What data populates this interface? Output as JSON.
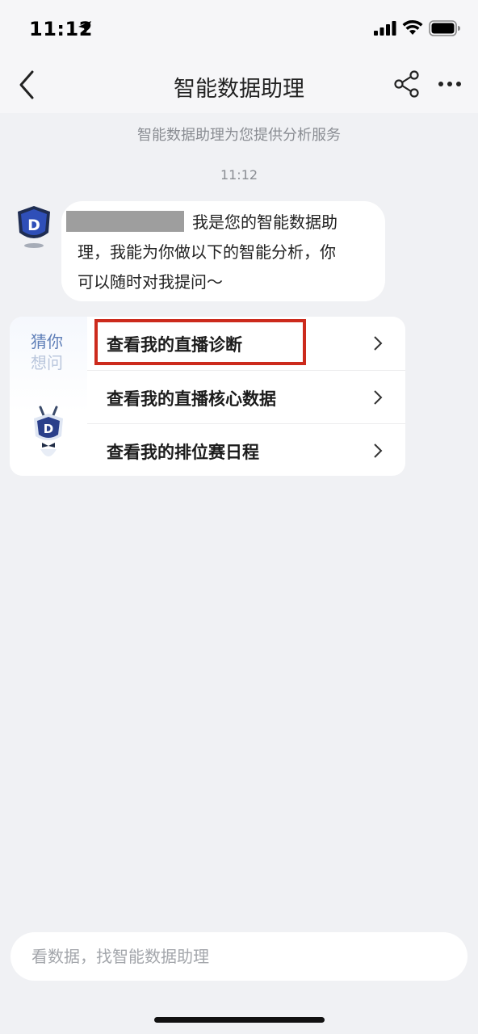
{
  "status_bar": {
    "time": "11:12"
  },
  "nav": {
    "title": "智能数据助理"
  },
  "chat": {
    "subtitle": "智能数据助理为您提供分析服务",
    "timestamp": "11:12",
    "greeting": {
      "line1": "我是您的智能数据助",
      "line2": "理，我能为你做以下的智能分析，你",
      "line3": "可以随时对我提问～"
    }
  },
  "suggestions": {
    "guess_label_1": "猜你",
    "guess_label_2": "想问",
    "items": [
      {
        "label": "查看我的直播诊断"
      },
      {
        "label": "查看我的直播核心数据"
      },
      {
        "label": "查看我的排位赛日程"
      }
    ]
  },
  "input": {
    "placeholder": "看数据，找智能数据助理"
  },
  "colors": {
    "background": "#f0f1f4",
    "highlight": "#cc2a1c",
    "brand_blue": "#2a56c6"
  }
}
